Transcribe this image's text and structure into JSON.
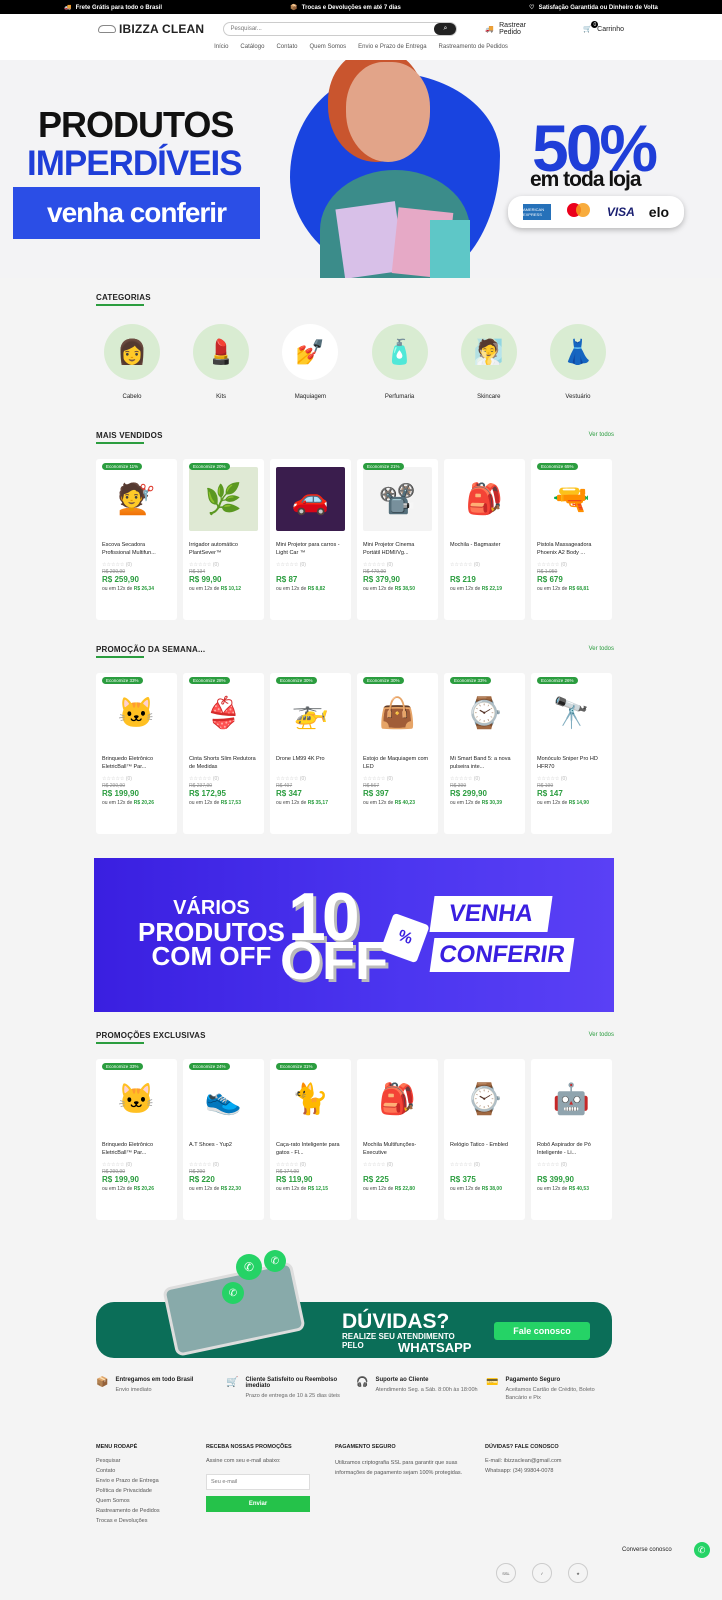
{
  "topbar": [
    {
      "icon": "truck-icon",
      "text": "Frete Grátis para todo o Brasil"
    },
    {
      "icon": "box-icon",
      "text": "Trocas e Devoluções em até 7 dias"
    },
    {
      "icon": "heart-icon",
      "text": "Satisfação Garantida ou Dinheiro de Volta"
    }
  ],
  "header": {
    "brand": "IBIZZA CLEAN",
    "search_placeholder": "Pesquisar...",
    "track": "Rastrear Pedido",
    "cart": "Carrinho",
    "cart_count": "0"
  },
  "nav": [
    "Início",
    "Catálogo",
    "Contato",
    "Quem Somos",
    "Envio e Prazo de Entrega",
    "Rastreamento de Pedidos"
  ],
  "hero": {
    "line1": "PRODUTOS",
    "line2": "IMPERDÍVEIS",
    "line3": "venha conferir",
    "pct": "50%",
    "pct_sub": "em toda loja",
    "cards": [
      "AMERICAN EXPRESS",
      "mastercard",
      "VISA",
      "elo"
    ]
  },
  "categories": {
    "title": "CATEGORIAS",
    "items": [
      {
        "label": "Cabelo",
        "emoji": "👩",
        "bg": "#d9ecd2"
      },
      {
        "label": "Kits",
        "emoji": "💄",
        "bg": "#d9ecd2"
      },
      {
        "label": "Maquiagem",
        "emoji": "💅",
        "bg": "#ffffff"
      },
      {
        "label": "Perfumaria",
        "emoji": "🧴",
        "bg": "#d9ecd2"
      },
      {
        "label": "Skincare",
        "emoji": "🧖",
        "bg": "#d9ecd2"
      },
      {
        "label": "Vestuário",
        "emoji": "👗",
        "bg": "#d9ecd2"
      }
    ]
  },
  "sections": [
    {
      "title": "MAIS VENDIDOS",
      "see_all": "Ver todos",
      "products": [
        {
          "disc": "Economize 11%",
          "emoji": "💇",
          "bg": "#fff",
          "name": "Escova Secadora Profissional Multifun...",
          "rating": "(0)",
          "old": "R$ 299,90",
          "price": "R$ 259,90",
          "inst_pre": "ou em 12x de",
          "inst": "R$ 26,34"
        },
        {
          "disc": "Economize 20%",
          "emoji": "🌿",
          "bg": "#dfe9d4",
          "name": "Irrigador automático PlantSever™",
          "rating": "(0)",
          "old": "R$ 134",
          "price": "R$ 99,90",
          "inst_pre": "ou em 12x de",
          "inst": "R$ 10,12"
        },
        {
          "disc": "",
          "emoji": "🚗",
          "bg": "#3a1d4d",
          "name": "Mini Projetor para carros - Light Car ™",
          "rating": "(0)",
          "old": "",
          "price": "R$ 87",
          "inst_pre": "ou em 12x de",
          "inst": "R$ 8,82"
        },
        {
          "disc": "Economize 21%",
          "emoji": "📽️",
          "bg": "#f3f3f3",
          "name": "Mini Projetor Cinema Portátil HDMI/Vg...",
          "rating": "(0)",
          "old": "R$ 479,90",
          "price": "R$ 379,90",
          "inst_pre": "ou em 12x de",
          "inst": "R$ 38,50"
        },
        {
          "disc": "",
          "emoji": "🎒",
          "bg": "#fff",
          "name": "Mochila - Bagmaster",
          "rating": "(0)",
          "old": "",
          "price": "R$ 219",
          "inst_pre": "ou em 12x de",
          "inst": "R$ 22,19"
        },
        {
          "disc": "Economize 65%",
          "emoji": "🔫",
          "bg": "#fff",
          "name": "Pistola Massageadora Phoenix A2 Body ...",
          "rating": "(0)",
          "old": "R$ 1.950",
          "price": "R$ 679",
          "inst_pre": "ou em 12x de",
          "inst": "R$ 68,81"
        }
      ]
    },
    {
      "title": "PROMOÇÃO DA SEMANA...",
      "see_all": "Ver todos",
      "products": [
        {
          "disc": "Economize 33%",
          "emoji": "🐱",
          "bg": "#fff",
          "name": "Brinquedo Eletrônico EletricBall™ Par...",
          "rating": "(0)",
          "old": "R$ 299,90",
          "price": "R$ 199,90",
          "inst_pre": "ou em 12x de",
          "inst": "R$ 20,26"
        },
        {
          "disc": "Economize 28%",
          "emoji": "👙",
          "bg": "#fff",
          "name": "Cinta Shorts Slim Redutora de Medidas",
          "rating": "(0)",
          "old": "R$ 237,90",
          "price": "R$ 172,95",
          "inst_pre": "ou em 12x de",
          "inst": "R$ 17,53"
        },
        {
          "disc": "Economize 30%",
          "emoji": "🚁",
          "bg": "#fff",
          "name": "Drone LM99 4K Pro",
          "rating": "(0)",
          "old": "R$ 497",
          "price": "R$ 347",
          "inst_pre": "ou em 12x de",
          "inst": "R$ 35,17"
        },
        {
          "disc": "Economize 30%",
          "emoji": "👜",
          "bg": "#fff",
          "name": "Estojo de Maquiagem com LED",
          "rating": "(0)",
          "old": "R$ 567",
          "price": "R$ 397",
          "inst_pre": "ou em 12x de",
          "inst": "R$ 40,23"
        },
        {
          "disc": "Economize 33%",
          "emoji": "⌚",
          "bg": "#fff",
          "name": "Mi Smart Band 5: a nova pulseira inte...",
          "rating": "(0)",
          "old": "R$ 399",
          "price": "R$ 299,90",
          "inst_pre": "ou em 12x de",
          "inst": "R$ 30,39"
        },
        {
          "disc": "Economize 26%",
          "emoji": "🔭",
          "bg": "#fff",
          "name": "Monóculo Sniper Pro HD HFR70",
          "rating": "(0)",
          "old": "R$ 199",
          "price": "R$ 147",
          "inst_pre": "ou em 12x de",
          "inst": "R$ 14,90"
        }
      ]
    },
    {
      "title": "PROMOÇÕES EXCLUSIVAS",
      "see_all": "Ver todos",
      "products": [
        {
          "disc": "Economize 33%",
          "emoji": "🐱",
          "bg": "#fff",
          "name": "Brinquedo Eletrônico EletricBall™ Par...",
          "rating": "(0)",
          "old": "R$ 299,90",
          "price": "R$ 199,90",
          "inst_pre": "ou em 12x de",
          "inst": "R$ 20,26"
        },
        {
          "disc": "Economize 24%",
          "emoji": "👟",
          "bg": "#fff",
          "name": "A.T Shoes - Yup2",
          "rating": "(0)",
          "old": "R$ 290",
          "price": "R$ 220",
          "inst_pre": "ou em 12x de",
          "inst": "R$ 22,30"
        },
        {
          "disc": "Economize 31%",
          "emoji": "🐈",
          "bg": "#fff",
          "name": "Caça-rato Inteligente para gatos - Fl...",
          "rating": "(0)",
          "old": "R$ 174,90",
          "price": "R$ 119,90",
          "inst_pre": "ou em 12x de",
          "inst": "R$ 12,15"
        },
        {
          "disc": "",
          "emoji": "🎒",
          "bg": "#fff",
          "name": "Mochila Multifunções-Executive",
          "rating": "(0)",
          "old": "",
          "price": "R$ 225",
          "inst_pre": "ou em 12x de",
          "inst": "R$ 22,80"
        },
        {
          "disc": "",
          "emoji": "⌚",
          "bg": "#fff",
          "name": "Relógio Tatico - Embled",
          "rating": "(0)",
          "old": "",
          "price": "R$ 375",
          "inst_pre": "ou em 12x de",
          "inst": "R$ 38,00"
        },
        {
          "disc": "",
          "emoji": "🤖",
          "bg": "#fff",
          "name": "Robô Aspirador de Pó Inteligente - Li...",
          "rating": "(0)",
          "old": "",
          "price": "R$ 399,90",
          "inst_pre": "ou em 12x de",
          "inst": "R$ 40,53"
        }
      ]
    }
  ],
  "promo": {
    "a": "VÁRIOS",
    "b": "PRODUTOS",
    "c": "COM OFF",
    "big": "10",
    "big2": "OFF",
    "tag": "%",
    "v1": "VENHA",
    "v2": "CONFERIR"
  },
  "whatsapp": {
    "l1": "DÚVIDAS?",
    "l2": "REALIZE SEU ATENDIMENTO",
    "l3": "PELO",
    "l4": "WHATSAPP",
    "button": "Fale conosco"
  },
  "features": [
    {
      "icon": "box-icon",
      "title": "Entregamos em todo Brasil",
      "sub": "Envio imediato"
    },
    {
      "icon": "cart-icon",
      "title": "Cliente Satisfeito ou Reembolso imediato",
      "sub": "Prazo de entrega de 10 à 25 dias úteis"
    },
    {
      "icon": "support-icon",
      "title": "Suporte ao Cliente",
      "sub": "Atendimento Seg. a Sáb. 8:00h às 18:00h"
    },
    {
      "icon": "card-icon",
      "title": "Pagamento Seguro",
      "sub": "Aceitamos Cartão de Crédito, Boleto Bancário e Pix"
    }
  ],
  "footer": {
    "menu_title": "MENU RODAPÉ",
    "menu": [
      "Pesquisar",
      "Contato",
      "Envio e Prazo de Entrega",
      "Política de Privacidade",
      "Quem Somos",
      "Rastreamento de Pedidos",
      "Trocas e Devoluções"
    ],
    "news_title": "RECEBA NOSSAS PROMOÇÕES",
    "news_text": "Assine com seu e-mail abaixo:",
    "news_placeholder": "Seu e-mail",
    "news_button": "Enviar",
    "pay_title": "PAGAMENTO SEGURO",
    "pay_text": "Utilizamos criptografia SSL para garantir que suas informações de pagamento sejam 100% protegidas.",
    "contact_title": "DÚVIDAS? FALE CONOSCO",
    "email": "E-mail: ibizzaclean@gmail.com",
    "phone": "Whatsapp: (34) 99804-0078"
  },
  "chat": "Converse conosco"
}
